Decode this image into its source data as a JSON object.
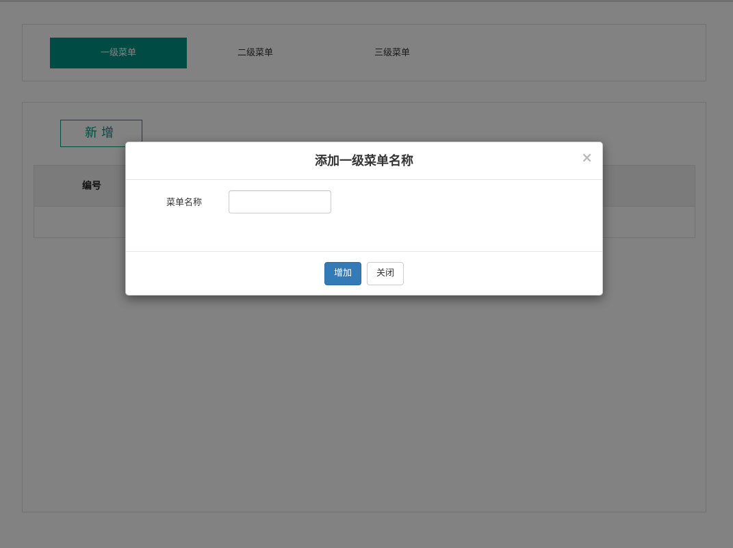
{
  "tabs": [
    {
      "label": "一级菜单",
      "active": true
    },
    {
      "label": "二级菜单",
      "active": false
    },
    {
      "label": "三级菜单",
      "active": false
    }
  ],
  "main": {
    "add_button_label": "新增",
    "table": {
      "columns": [
        "编号"
      ]
    }
  },
  "modal": {
    "title": "添加一级菜单名称",
    "close_symbol": "×",
    "field_label": "菜单名称",
    "field_value": "",
    "submit_label": "增加",
    "close_label": "关闭"
  },
  "colors": {
    "accent": "#009688",
    "primary_button": "#337ab7"
  }
}
